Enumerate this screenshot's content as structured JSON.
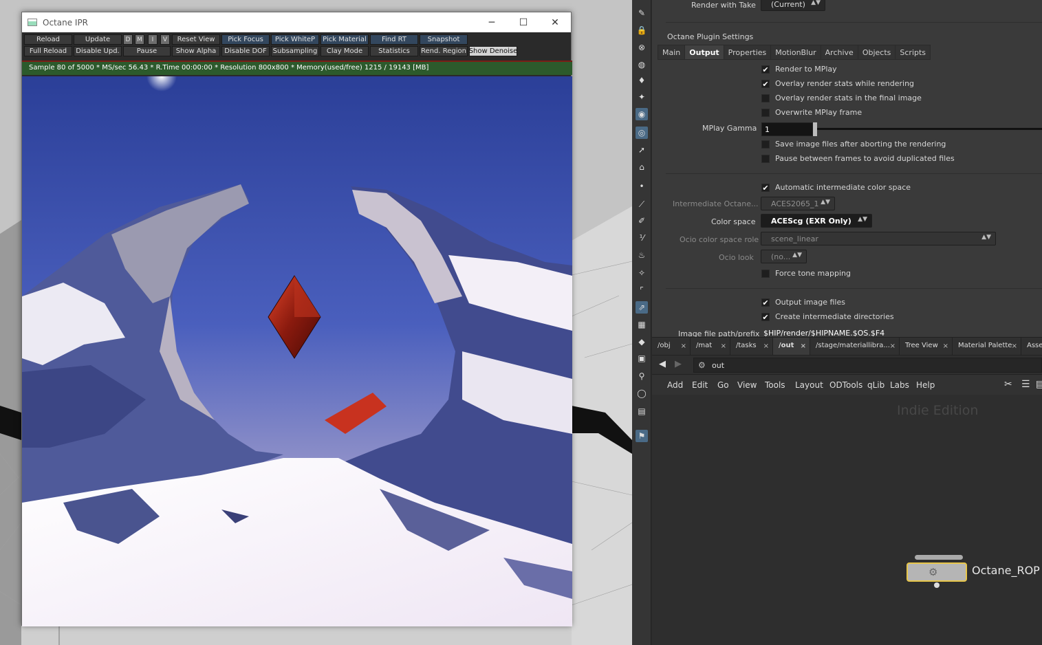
{
  "ipr_window": {
    "title": "Octane IPR",
    "minimize": "─",
    "maximize": "☐",
    "close": "✕",
    "toolbar_row1": [
      "Reload",
      "Update",
      "D",
      "M",
      "I",
      "V",
      "Reset View",
      "Pick Focus",
      "Pick WhiteP",
      "Pick Material",
      "Find RT",
      "Snapshot"
    ],
    "toolbar_row2": [
      "Full Reload",
      "Disable Upd.",
      "Pause",
      "Show Alpha",
      "Disable DOF",
      "Subsampling",
      "Clay Mode",
      "Statistics",
      "Rend. Region",
      "Show Denoise"
    ],
    "status": "Sample 80 of 5000 * MS/sec 56.43 * R.Time 00:00:00 * Resolution 800x800 * Memory(used/free) 1215 / 19143 [MB]"
  },
  "params": {
    "render_with_take_label": "Render with Take",
    "render_with_take_value": "(Current)",
    "section_title": "Octane Plugin Settings",
    "tabs": [
      "Main",
      "Output",
      "Properties",
      "MotionBlur",
      "Archive",
      "Objects",
      "Scripts"
    ],
    "active_tab": "Output",
    "checkboxes": [
      {
        "label": "Render to MPlay",
        "checked": true
      },
      {
        "label": "Overlay render stats while rendering",
        "checked": true
      },
      {
        "label": "Overlay render stats in the final image",
        "checked": false
      },
      {
        "label": "Overwrite MPlay frame",
        "checked": false
      },
      {
        "label": "Save image files after aborting the rendering",
        "checked": false
      },
      {
        "label": "Pause between frames to avoid duplicated files",
        "checked": false
      },
      {
        "label": "Automatic intermediate color space",
        "checked": true
      },
      {
        "label": "Force tone mapping",
        "checked": false
      },
      {
        "label": "Output image files",
        "checked": true
      },
      {
        "label": "Create intermediate directories",
        "checked": true
      }
    ],
    "mplay_gamma_label": "MPlay Gamma",
    "mplay_gamma_value": "1",
    "intermediate_label": "Intermediate Octane...",
    "intermediate_value": "ACES2065_1",
    "color_space_label": "Color space",
    "color_space_value": "ACEScg (EXR Only)",
    "ocio_role_label": "Ocio color space role",
    "ocio_role_value": "scene_linear",
    "ocio_look_label": "Ocio look",
    "ocio_look_value": "(no...",
    "image_path_label": "Image file path/prefix",
    "image_path_value": "$HIP/render/$HIPNAME.$OS.$F4"
  },
  "network": {
    "tabs": [
      "/obj",
      "/mat",
      "/tasks",
      "/out",
      "/stage/materiallibra...",
      "Tree View",
      "Material Palette",
      "Asse"
    ],
    "path": "out",
    "menus": [
      "Add",
      "Edit",
      "Go",
      "View",
      "Tools",
      "Layout",
      "ODTools",
      "qLib",
      "Labs",
      "Help"
    ],
    "watermark": "Indie Edition",
    "node_label": "Octane_ROP"
  },
  "icons": {
    "close_x": "×"
  }
}
